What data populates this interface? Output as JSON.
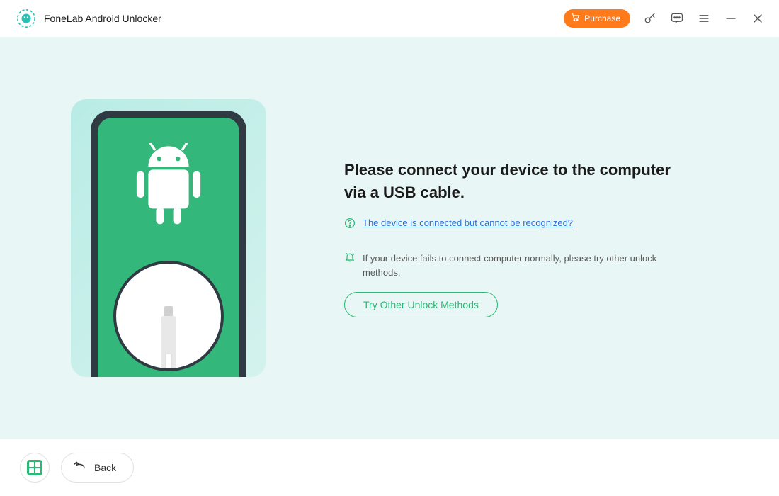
{
  "titlebar": {
    "app_title": "FoneLab Android Unlocker",
    "purchase_label": "Purchase"
  },
  "main": {
    "headline": "Please connect your device to the computer via a USB cable.",
    "help_link_text": "The device is connected but cannot be recognized?",
    "tip_text": "If your device fails to connect computer normally, please try other unlock methods.",
    "try_other_label": "Try Other Unlock Methods"
  },
  "footer": {
    "back_label": "Back"
  },
  "colors": {
    "accent_green": "#2bb774",
    "accent_orange": "#ff7a1a",
    "link_blue": "#2b6fd8"
  }
}
